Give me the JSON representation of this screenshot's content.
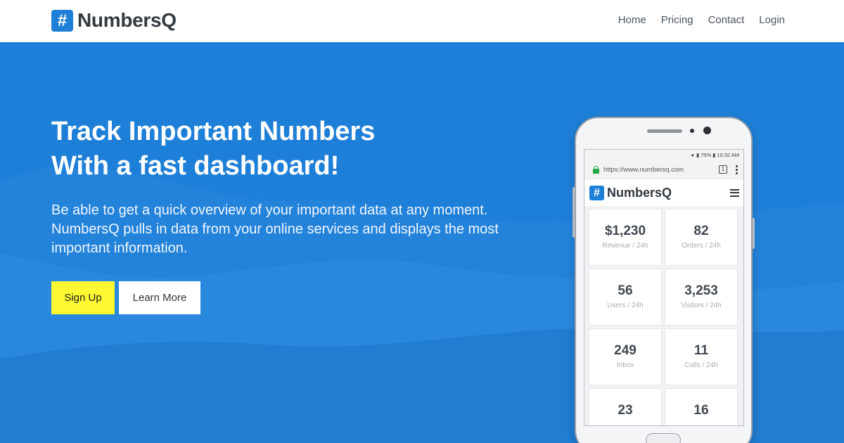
{
  "brand": {
    "icon": "#",
    "name": "NumbersQ"
  },
  "nav": [
    {
      "label": "Home"
    },
    {
      "label": "Pricing"
    },
    {
      "label": "Contact"
    },
    {
      "label": "Login"
    }
  ],
  "hero": {
    "headline_line1": "Track Important Numbers",
    "headline_line2": "With a fast dashboard!",
    "subtext": "Be able to get a quick overview of your important data at any moment. NumbersQ pulls in data from your online services and displays the most important information.",
    "signup_label": "Sign Up",
    "learn_more_label": "Learn More"
  },
  "phone": {
    "status": {
      "battery": "75%",
      "time": "10:32 AM"
    },
    "browser": {
      "url": "https://www.numbersq.com",
      "tab_count": "1"
    },
    "app": {
      "icon": "#",
      "name": "NumbersQ"
    },
    "cards": [
      {
        "value": "$1,230",
        "label": "Revenue / 24h"
      },
      {
        "value": "82",
        "label": "Orders / 24h"
      },
      {
        "value": "56",
        "label": "Users / 24h"
      },
      {
        "value": "3,253",
        "label": "Visitors / 24h"
      },
      {
        "value": "249",
        "label": "Inbox"
      },
      {
        "value": "11",
        "label": "Calls / 24h"
      },
      {
        "value": "23",
        "label": ""
      },
      {
        "value": "16",
        "label": ""
      }
    ]
  },
  "colors": {
    "hero_background": "#1e7fd8",
    "signup_button": "#fdf832",
    "brand_blue": "#1e7fd8",
    "lock_green": "#23a845"
  }
}
